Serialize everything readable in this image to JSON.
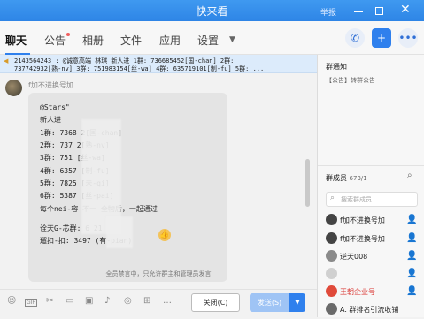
{
  "window": {
    "title": "快来看",
    "feedback": "举报"
  },
  "nav": {
    "tabs": [
      {
        "label": "聊天"
      },
      {
        "label": "公告"
      },
      {
        "label": "相册"
      },
      {
        "label": "文件"
      },
      {
        "label": "应用"
      },
      {
        "label": "设置"
      }
    ]
  },
  "banner": {
    "lines": [
      "2143564243  :  @诚意高端    林琪 新人进 1群:  736685452[国-chan] 2群:",
      "737742932[熟-nv] 3群: 751983154[丝-wa] 4群: 635719101[制-fu] 5群: ..."
    ]
  },
  "message": {
    "sender": "f加不进换号加",
    "lines": [
      "@Stars\"",
      "新人进",
      "1群: 7368    2[国-chan]",
      "2群: 737     2[熟-nv]",
      "3群: 751     [丝-wa]",
      "4群: 6357    [制-fu]",
      "5群: 7825    [未-qi]",
      "6群: 5387    [丝-pai]",
      "每个nei-容 不一 全物后，一起通过",
      "诠天G-芯群: 6      21",
      "遛扣-扣: 3497      (有-pian)"
    ]
  },
  "toolbar": {
    "gif_label": "GIF"
  },
  "footer": {
    "mute_notice": "全员禁言中，只允许群主和管理员发言",
    "close_label": "关闭(C)",
    "send_label": "发送(S)"
  },
  "sidebar": {
    "notice_title": "群通知",
    "notice_body": "【公告】转群公告",
    "members_title": "群成员",
    "members_count": "673/1",
    "search_placeholder": "搜索群成员",
    "members": [
      {
        "name": "f加不进换号加",
        "name_color": "#222222"
      },
      {
        "name": "f加不进换号加",
        "name_color": "#222222"
      },
      {
        "name": "逆天008",
        "name_color": "#222222"
      },
      {
        "name": "",
        "name_color": "#222222"
      },
      {
        "name": "王朝企业号",
        "name_color": "#d9302c"
      },
      {
        "name": "A. 群排名引流收铺",
        "name_color": "#222222"
      }
    ]
  },
  "colors": {
    "accent": "#2f80ed",
    "titlebar": "#3592ef",
    "highlight": "#d9302c"
  }
}
